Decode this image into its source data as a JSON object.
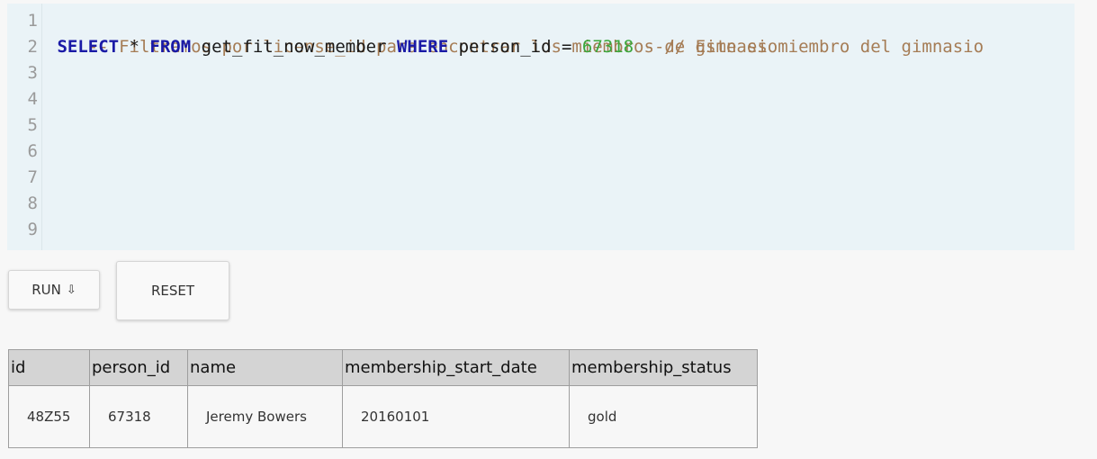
{
  "editor": {
    "line_numbers": [
      "1",
      "2",
      "3",
      "4",
      "5",
      "6",
      "7",
      "8",
      "9"
    ],
    "line1": {
      "comment": "-- Filtramos por license_id para encontrar los miembros de gimnasio"
    },
    "line2": {
      "indent": " ",
      "kw_select": "SELECT",
      "star": " * ",
      "kw_from": "FROM",
      "table": " get_fit_now_member ",
      "kw_where": "WHERE",
      "condition": " person_id = ",
      "value": "67318",
      "comment": " --// Este es miembro del gimnasio"
    }
  },
  "buttons": {
    "run_label": "RUN",
    "run_icon": "⇩",
    "reset_label": "RESET"
  },
  "results": {
    "headers": [
      "id",
      "person_id",
      "name",
      "membership_start_date",
      "membership_status"
    ],
    "rows": [
      [
        "48Z55",
        "67318",
        "Jeremy Bowers",
        "20160101",
        "gold"
      ]
    ]
  },
  "colors": {
    "editor_bg": "#eaf3f7",
    "comment": "#a57c55",
    "keyword": "#1a1aa6",
    "number": "#3aa63a",
    "header_bg": "#d4d4d4"
  }
}
